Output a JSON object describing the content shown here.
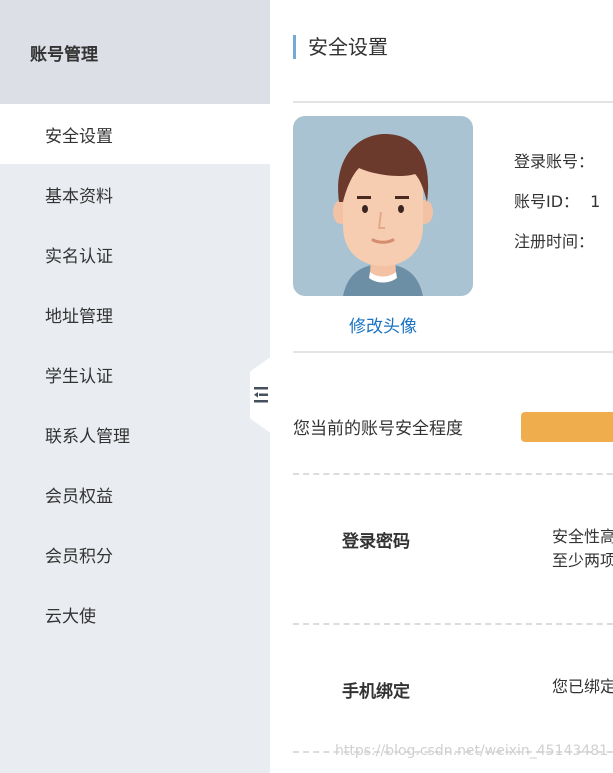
{
  "sidebar": {
    "title": "账号管理",
    "items": [
      {
        "label": "安全设置"
      },
      {
        "label": "基本资料"
      },
      {
        "label": "实名认证"
      },
      {
        "label": "地址管理"
      },
      {
        "label": "学生认证"
      },
      {
        "label": "联系人管理"
      },
      {
        "label": "会员权益"
      },
      {
        "label": "会员积分"
      },
      {
        "label": "云大使"
      }
    ]
  },
  "main": {
    "title": "安全设置",
    "avatar": {
      "edit_label": "修改头像"
    },
    "account": {
      "login_account_label": "登录账号：",
      "account_id_label": "账号ID：",
      "account_id_value": "1",
      "register_time_label": "注册时间："
    },
    "security_level": {
      "label": "您当前的账号安全程度",
      "bar_color": "#f0ad4e"
    },
    "items": [
      {
        "name": "登录密码",
        "desc_line1": "安全性高",
        "desc_line2": "至少两项"
      },
      {
        "name": "手机绑定",
        "desc_line1": "您已绑定"
      }
    ]
  },
  "watermark": "https://blog.csdn.net/weixin_45143481"
}
